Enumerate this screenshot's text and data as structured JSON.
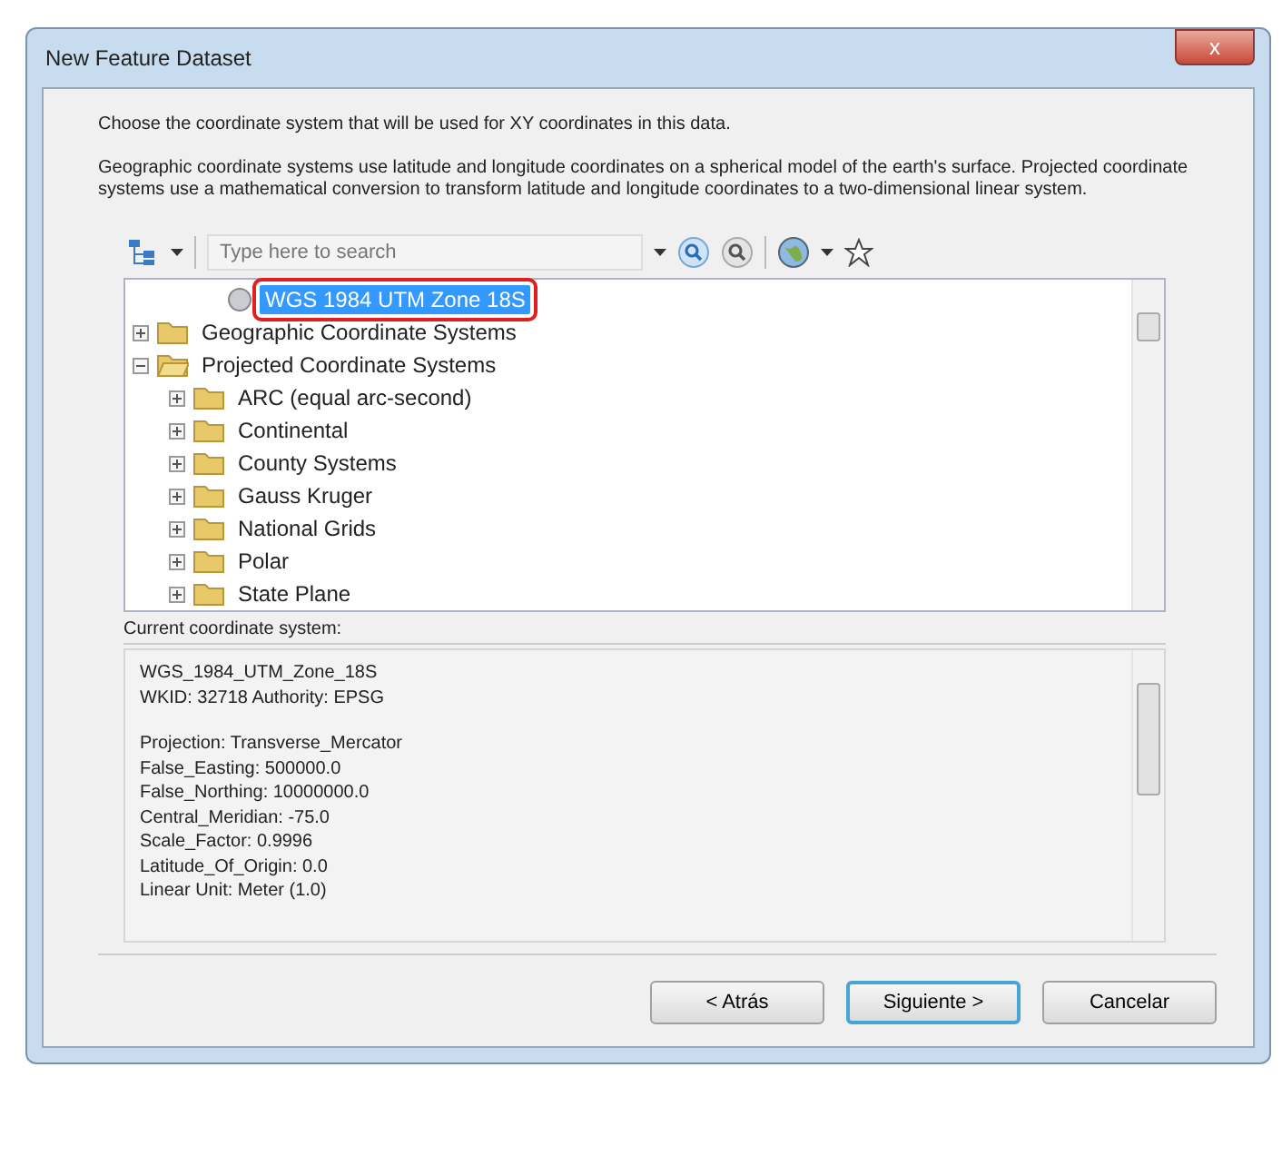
{
  "window": {
    "title": "New Feature Dataset",
    "close_label": "x"
  },
  "intro": "Choose the coordinate system that will be used for XY coordinates in this data.",
  "explanation": "Geographic coordinate systems use latitude and longitude coordinates on a spherical model of the earth's surface. Projected coordinate systems use a mathematical conversion to transform latitude and longitude coordinates to a two-dimensional linear system.",
  "search": {
    "placeholder": "Type here to search"
  },
  "tree": [
    {
      "label": "WGS 1984 UTM Zone 18S",
      "kind": "system",
      "selected": true
    },
    {
      "label": "Geographic Coordinate Systems",
      "kind": "folder",
      "expanded": false,
      "selected": false
    },
    {
      "label": "Projected Coordinate Systems",
      "kind": "folder",
      "expanded": true,
      "selected": false,
      "children": [
        {
          "label": "ARC (equal arc-second)",
          "kind": "folder",
          "expanded": false,
          "selected": false
        },
        {
          "label": "Continental",
          "kind": "folder",
          "expanded": false,
          "selected": false
        },
        {
          "label": "County Systems",
          "kind": "folder",
          "expanded": false,
          "selected": false
        },
        {
          "label": "Gauss Kruger",
          "kind": "folder",
          "expanded": false,
          "selected": false
        },
        {
          "label": "National Grids",
          "kind": "folder",
          "expanded": false,
          "selected": false
        },
        {
          "label": "Polar",
          "kind": "folder",
          "expanded": false,
          "selected": false
        },
        {
          "label": "State Plane",
          "kind": "folder",
          "expanded": false,
          "selected": false
        }
      ]
    }
  ],
  "current": {
    "label": "Current coordinate system:",
    "groups": [
      [
        "WGS_1984_UTM_Zone_18S",
        "WKID: 32718 Authority: EPSG"
      ],
      [
        "Projection: Transverse_Mercator",
        "False_Easting: 500000.0",
        "False_Northing: 10000000.0",
        "Central_Meridian: -75.0",
        "Scale_Factor: 0.9996",
        "Latitude_Of_Origin: 0.0",
        "Linear Unit: Meter (1.0)"
      ]
    ]
  },
  "buttons": [
    {
      "label": "< Atrás",
      "selected": false
    },
    {
      "label": "Siguiente >",
      "selected": true
    },
    {
      "label": "Cancelar",
      "selected": false
    }
  ]
}
